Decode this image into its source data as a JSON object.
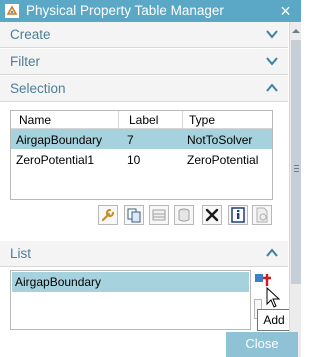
{
  "window": {
    "title": "Physical Property Table Manager",
    "close_glyph": "×"
  },
  "groups": {
    "create": {
      "label": "Create"
    },
    "filter": {
      "label": "Filter"
    },
    "selection": {
      "label": "Selection"
    },
    "list": {
      "label": "List"
    }
  },
  "selection_table": {
    "columns": [
      "Name",
      "Label",
      "Type"
    ],
    "rows": [
      {
        "name": "AirgapBoundary",
        "label": "7",
        "type": "NotToSolver",
        "selected": true
      },
      {
        "name": "ZeroPotential1",
        "label": "10",
        "type": "ZeroPotential",
        "selected": false
      }
    ]
  },
  "toolbar": {
    "icons": [
      "wrench-icon",
      "copy-icon",
      "table-edit-icon",
      "database-icon",
      "delete-icon",
      "info-icon",
      "document-icon"
    ]
  },
  "list": {
    "items": [
      "AirgapBoundary"
    ],
    "add_icon": "add-icon"
  },
  "tooltip": {
    "text": "Add"
  },
  "footer": {
    "close_label": "Close"
  },
  "colors": {
    "titlebar": "#5aa8c5",
    "accent_text": "#4d7e96",
    "selected_row": "#a6d2dd",
    "close_button": "#8fc2d5"
  }
}
